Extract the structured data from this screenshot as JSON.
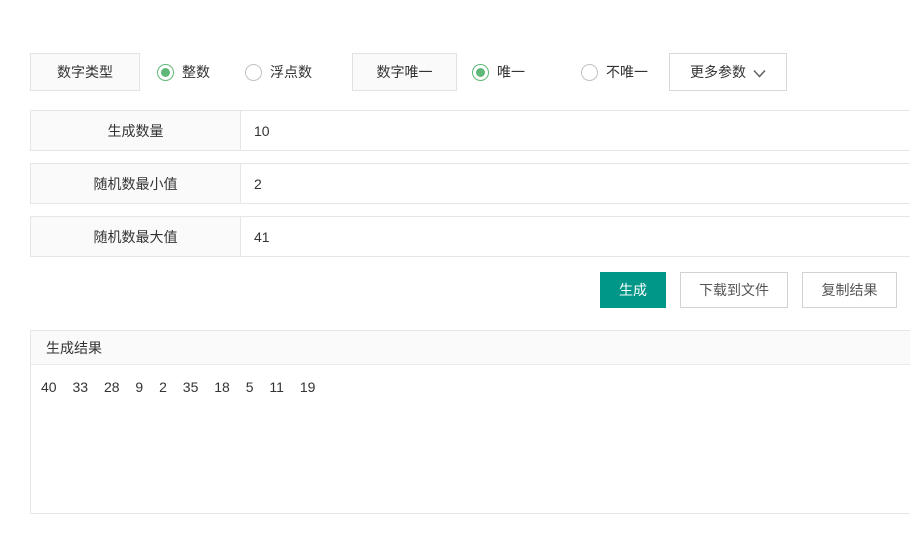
{
  "colors": {
    "primary_button": "#009688",
    "radio_checked": "#5FB878",
    "border": "#e6e6e6",
    "label_background": "#fafafa"
  },
  "top_controls": {
    "number_type": {
      "label": "数字类型",
      "options": [
        {
          "label": "整数",
          "selected": true
        },
        {
          "label": "浮点数",
          "selected": false
        }
      ]
    },
    "uniqueness": {
      "label": "数字唯一",
      "options": [
        {
          "label": "唯一",
          "selected": true
        },
        {
          "label": "不唯一",
          "selected": false
        }
      ]
    },
    "more_params_label": "更多参数"
  },
  "fields": [
    {
      "label": "生成数量",
      "value": "10"
    },
    {
      "label": "随机数最小值",
      "value": "2"
    },
    {
      "label": "随机数最大值",
      "value": "41"
    }
  ],
  "actions": {
    "generate_label": "生成",
    "download_label": "下载到文件",
    "copy_label": "复制结果"
  },
  "result": {
    "header": "生成结果",
    "values": [
      "40",
      "33",
      "28",
      "9",
      "2",
      "35",
      "18",
      "5",
      "11",
      "19"
    ]
  }
}
